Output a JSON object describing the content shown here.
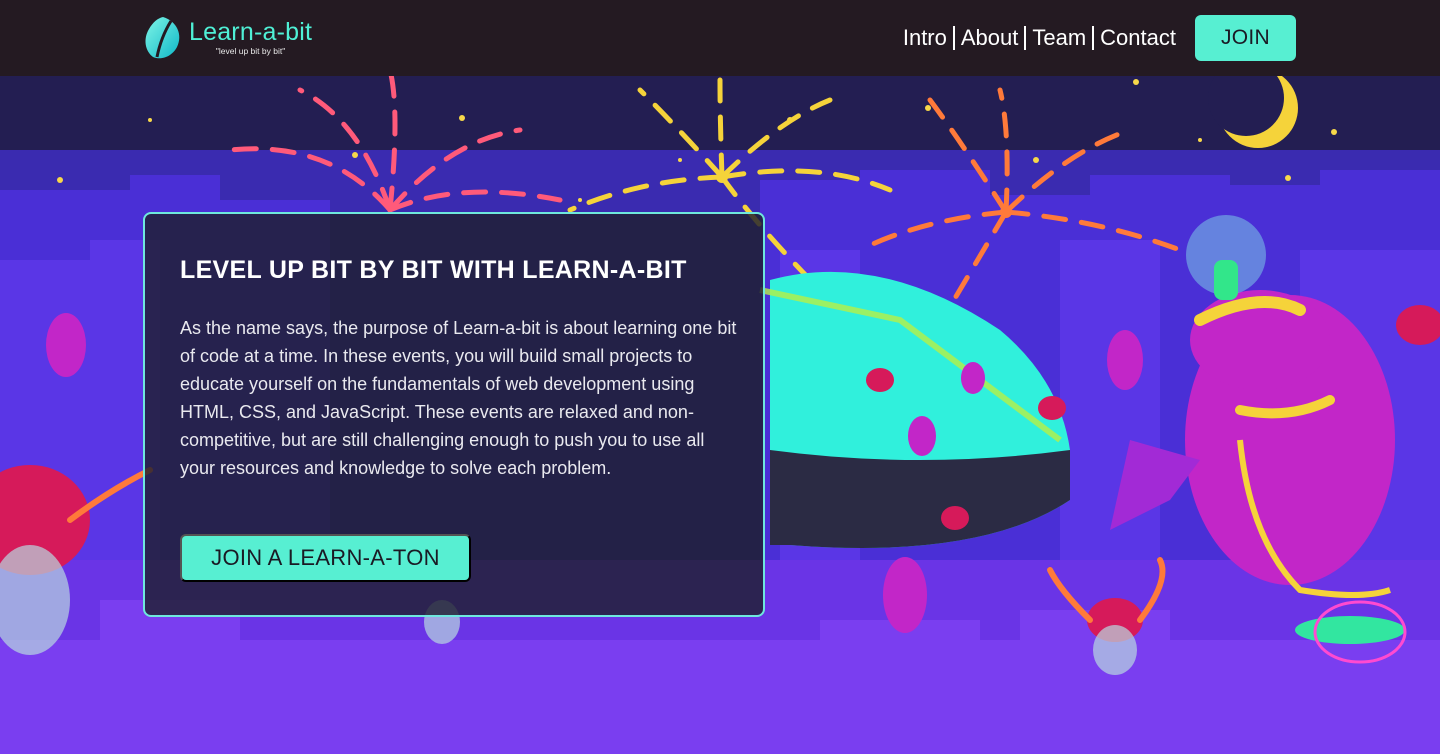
{
  "header": {
    "brand_name": "Learn-a-bit",
    "brand_tagline": "\"level up bit by bit\"",
    "nav": [
      {
        "label": "Intro"
      },
      {
        "label": "About"
      },
      {
        "label": "Team"
      },
      {
        "label": "Contact"
      }
    ],
    "join_label": "JOIN"
  },
  "hero": {
    "title": "LEVEL UP BIT BY BIT WITH LEARN-A-BIT",
    "description": "As the name says, the purpose of Learn-a-bit is about learning one bit of code at a time. In these events, you will build small projects to educate yourself on the fundamentals of web development using HTML, CSS, and JavaScript. These events are relaxed and non-competitive, but are still challenging enough to push you to use all your resources and knowledge to solve each problem.",
    "cta_label": "JOIN A LEARN-A-TON",
    "background_icon": "night-city-fireworks-illustration"
  },
  "colors": {
    "header_bg": "#241a22",
    "accent": "#57efd2",
    "card_border": "#6ee8dd",
    "sky": "#231e52",
    "city_purple": "#5a2fe0",
    "dome_cyan": "#30f0dc",
    "robot_magenta": "#c226c8"
  }
}
